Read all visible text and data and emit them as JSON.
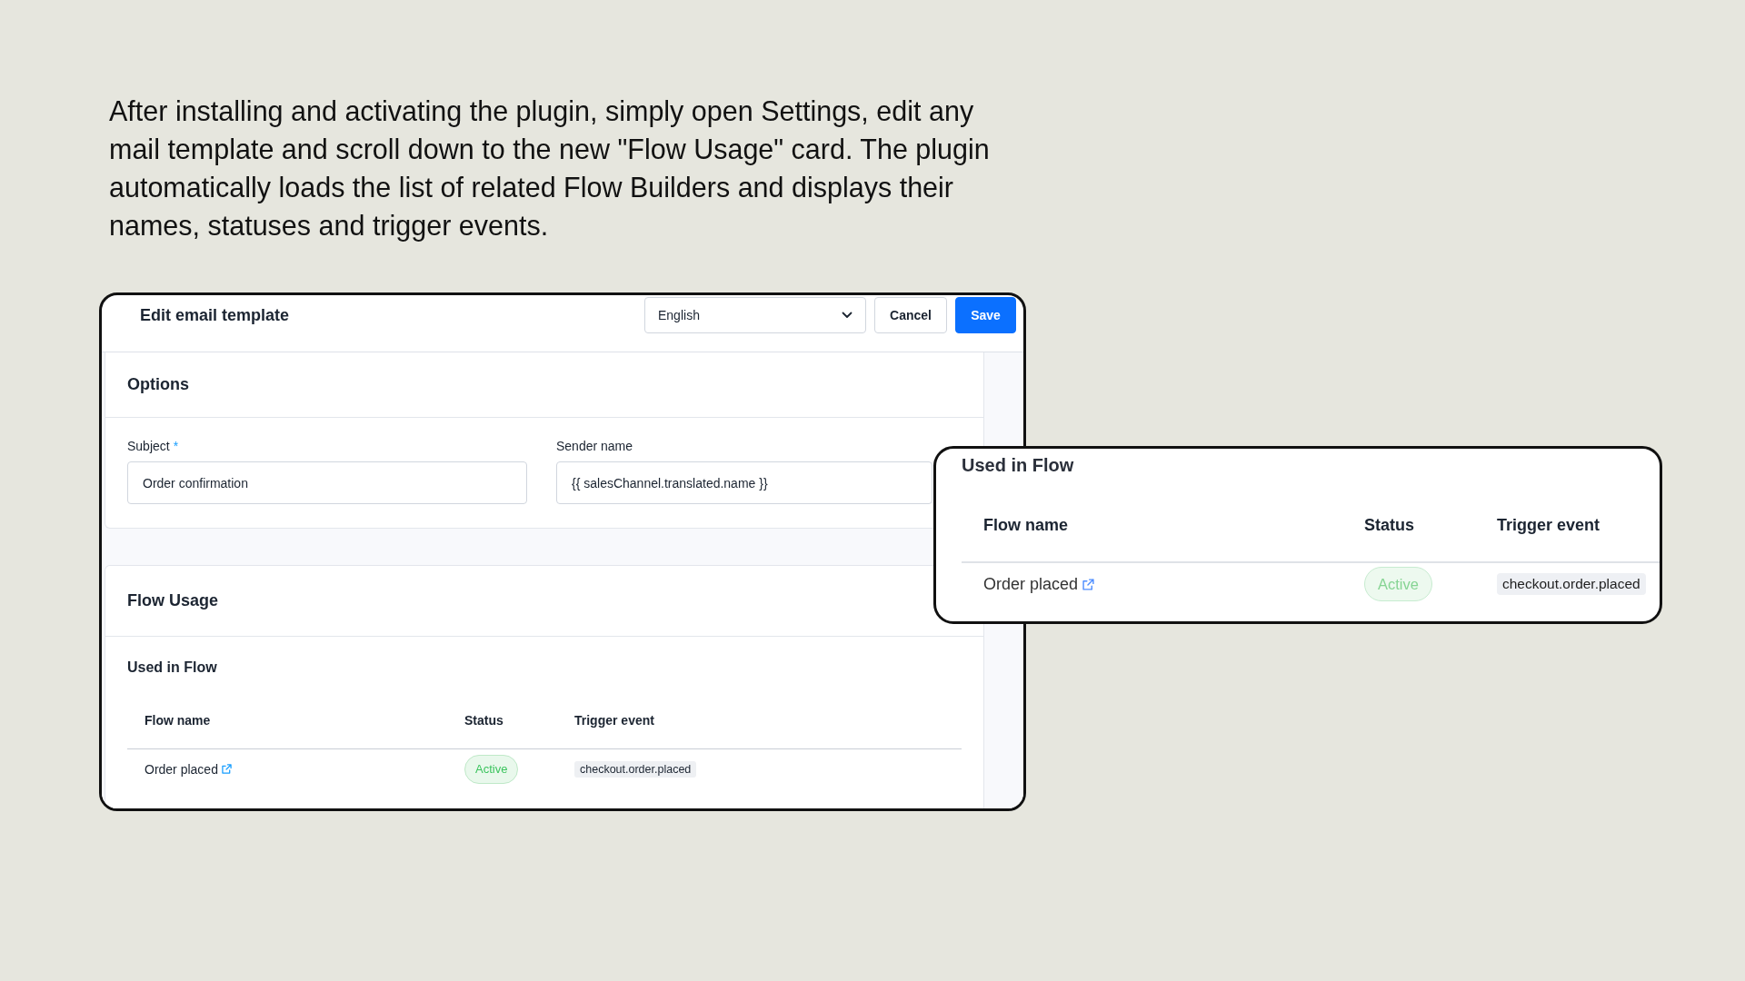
{
  "description": "After installing and activating the plugin, simply open Settings, edit any mail template and scroll down to the new \"Flow Usage\" card. The plugin automatically loads the list of related Flow Builders and displays their names, statuses and trigger events.",
  "editor": {
    "title": "Edit email template",
    "language_select": {
      "value": "English"
    },
    "buttons": [
      {
        "label": "Cancel",
        "kind": "secondary"
      },
      {
        "label": "Save",
        "kind": "primary"
      }
    ],
    "options_card": {
      "title": "Options",
      "fields": [
        {
          "label": "Subject",
          "required_mark": "*",
          "value": "Order confirmation"
        },
        {
          "label": "Sender name",
          "value": "{{ salesChannel.translated.name }}"
        }
      ]
    },
    "flow_usage_card": {
      "title": "Flow Usage",
      "section_title": "Used in Flow",
      "table": {
        "columns": [
          "Flow name",
          "Status",
          "Trigger event"
        ],
        "rows": [
          {
            "flow_name": "Order placed",
            "external_link": true,
            "status": "Active",
            "trigger_event": "checkout.order.placed"
          }
        ]
      }
    }
  },
  "zoom_callout": {
    "title": "Used in Flow",
    "table": {
      "columns": [
        "Flow name",
        "Status",
        "Trigger event"
      ],
      "rows": [
        {
          "flow_name": "Order placed",
          "external_link": true,
          "status": "Active",
          "trigger_event": "checkout.order.placed"
        }
      ]
    }
  }
}
